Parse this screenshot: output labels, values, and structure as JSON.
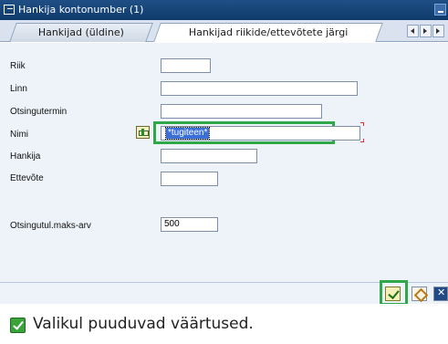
{
  "window": {
    "title": "Hankija kontonumber (1)"
  },
  "tabs": [
    {
      "label": "Hankijad (üldine)",
      "active": false
    },
    {
      "label": "Hankijad riikide/ettevõtete järgi",
      "active": true
    }
  ],
  "form": {
    "fields": [
      {
        "label": "Riik",
        "value": ""
      },
      {
        "label": "Linn",
        "value": ""
      },
      {
        "label": "Otsingutermin",
        "value": ""
      },
      {
        "label": "Nimi",
        "value": "*tugiteen*"
      },
      {
        "label": "Hankija",
        "value": ""
      },
      {
        "label": "Ettevõte",
        "value": ""
      },
      {
        "label": "Otsingutul.maks-arv",
        "value": "500"
      }
    ]
  },
  "colors": {
    "highlight": "#2fa84a",
    "title_bar": "#1f4f86",
    "selection": "#3a6fd8"
  },
  "icons": [
    "window-icon",
    "minimize-icon",
    "multiple-selection-icon",
    "confirm-icon",
    "multi-select-icon",
    "cancel-icon",
    "status-ok-icon"
  ],
  "status": {
    "message": "Valikul puuduvad väärtused."
  }
}
